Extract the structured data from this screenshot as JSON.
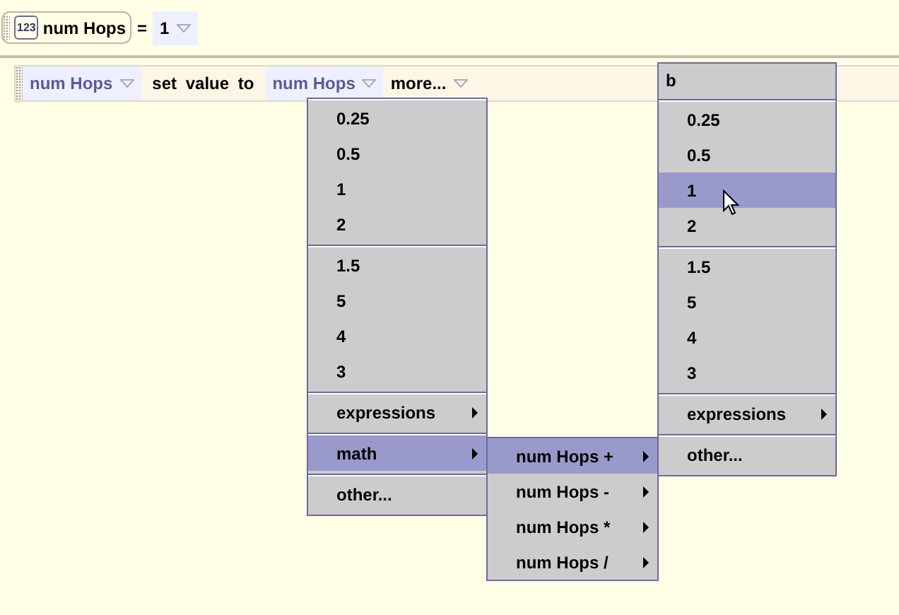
{
  "variable": {
    "icon_label": "123",
    "name": "num Hops",
    "operator": "=",
    "value": "1"
  },
  "statement": {
    "target": "num Hops",
    "text": "set value to",
    "value": "num Hops",
    "more": "more..."
  },
  "menus": [
    {
      "kind": "menu",
      "groups": [
        [
          {
            "label": "0.25",
            "selected": false,
            "submenu": false
          },
          {
            "label": "0.5",
            "selected": false,
            "submenu": false
          },
          {
            "label": "1",
            "selected": false,
            "submenu": false
          },
          {
            "label": "2",
            "selected": false,
            "submenu": false
          }
        ],
        [
          {
            "label": "1.5",
            "selected": false,
            "submenu": false
          },
          {
            "label": "5",
            "selected": false,
            "submenu": false
          },
          {
            "label": "4",
            "selected": false,
            "submenu": false
          },
          {
            "label": "3",
            "selected": false,
            "submenu": false
          }
        ],
        [
          {
            "label": "expressions",
            "selected": false,
            "submenu": true
          }
        ],
        [
          {
            "label": "math",
            "selected": true,
            "submenu": true
          }
        ],
        [
          {
            "label": "other...",
            "selected": false,
            "submenu": false
          }
        ]
      ]
    },
    {
      "kind": "submenu",
      "groups": [
        [
          {
            "label": "num Hops +",
            "selected": true,
            "submenu": true
          },
          {
            "label": "num Hops -",
            "selected": false,
            "submenu": true
          },
          {
            "label": "num Hops *",
            "selected": false,
            "submenu": true
          },
          {
            "label": "num Hops /",
            "selected": false,
            "submenu": true
          }
        ]
      ]
    },
    {
      "kind": "menu",
      "header": "b",
      "groups": [
        [
          {
            "label": "0.25",
            "selected": false,
            "submenu": false
          },
          {
            "label": "0.5",
            "selected": false,
            "submenu": false
          },
          {
            "label": "1",
            "selected": true,
            "submenu": false
          },
          {
            "label": "2",
            "selected": false,
            "submenu": false
          }
        ],
        [
          {
            "label": "1.5",
            "selected": false,
            "submenu": false
          },
          {
            "label": "5",
            "selected": false,
            "submenu": false
          },
          {
            "label": "4",
            "selected": false,
            "submenu": false
          },
          {
            "label": "3",
            "selected": false,
            "submenu": false
          }
        ],
        [
          {
            "label": "expressions",
            "selected": false,
            "submenu": true
          }
        ],
        [
          {
            "label": "other...",
            "selected": false,
            "submenu": false
          }
        ]
      ]
    }
  ]
}
